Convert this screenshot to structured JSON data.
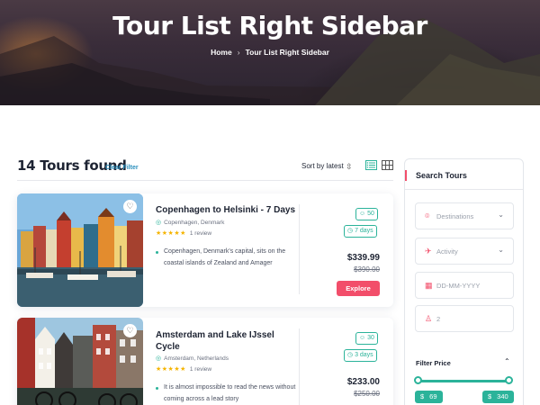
{
  "hero": {
    "title": "Tour List Right Sidebar",
    "breadcrumb": [
      "Home",
      "Tour List Right Sidebar"
    ]
  },
  "list_header": {
    "found_text": "14 Tours found",
    "clear_filter": "Clear Filter",
    "sort_label": "Sort by latest",
    "view_modes": [
      "list-view-icon",
      "grid-view-icon"
    ],
    "active_view": "list"
  },
  "tours": [
    {
      "title": "Copenhagen to Helsinki - 7 Days",
      "location": "Copenhagen, Denmark",
      "rating_stars": 5,
      "reviews": "1 review",
      "description": "Copenhagen, Denmark's capital, sits on the coastal islands of Zealand and Amager",
      "group_size": "50",
      "duration": "7 days",
      "price": "$339.99",
      "old_price": "$390.00",
      "cta": "Explore"
    },
    {
      "title": "Amsterdam and Lake IJssel Cycle",
      "location": "Amsterdam, Netherlands",
      "rating_stars": 5,
      "reviews": "1 review",
      "description": "It is almost impossible to read the news without coming across a lead story",
      "group_size": "30",
      "duration": "3 days",
      "price": "$233.00",
      "old_price": "$250.00"
    }
  ],
  "sidebar": {
    "title": "Search Tours",
    "destinations_placeholder": "Destinations",
    "activity_placeholder": "Activity",
    "date_placeholder": "DD-MM-YYYY",
    "guests_value": "2",
    "filter_price_title": "Filter Price",
    "price_min": "69",
    "price_max": "340",
    "currency": "$"
  },
  "colors": {
    "accent_red": "#f24e6a",
    "accent_teal": "#2bb39a",
    "link_blue": "#2a8fbd",
    "text_dark": "#1e2433"
  }
}
